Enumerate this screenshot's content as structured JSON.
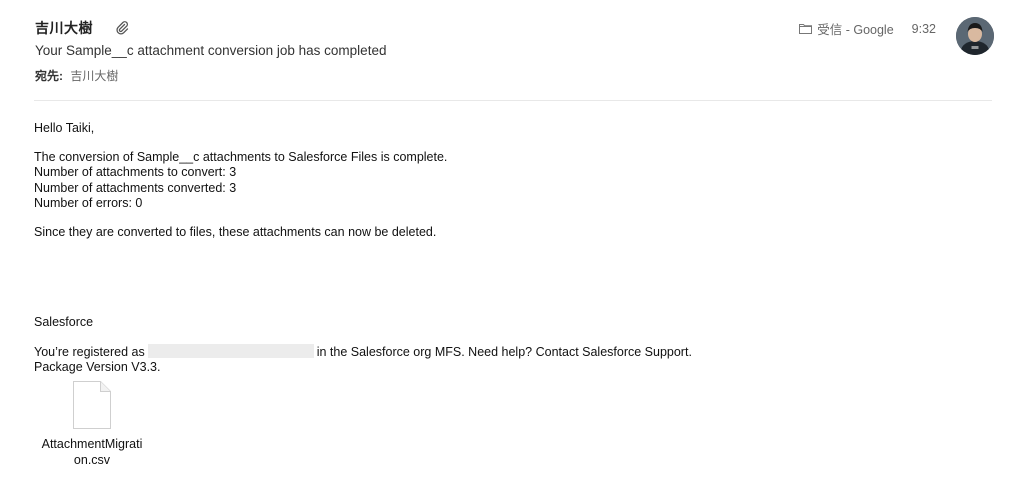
{
  "header": {
    "sender": "吉川大樹",
    "subject": "Your Sample__c attachment conversion job has completed",
    "recipient_label": "宛先:",
    "recipient_name": "吉川大樹",
    "folder": "受信 - Google",
    "time": "9:32"
  },
  "body": {
    "greeting": "Hello Taiki,",
    "line1": "The conversion of Sample__c attachments to Salesforce Files is complete.",
    "line2": "Number of attachments to convert: 3",
    "line3": "Number of attachments converted: 3",
    "line4": "Number of errors: 0",
    "line5": "Since they are converted to files, these attachments can now be deleted.",
    "signature": "Salesforce",
    "registered_prefix": "You’re registered as",
    "registered_suffix": "in the Salesforce org MFS. Need help? Contact Salesforce Support.",
    "package_version": "Package Version V3.3."
  },
  "attachment": {
    "file_name": "AttachmentMigration.csv"
  }
}
